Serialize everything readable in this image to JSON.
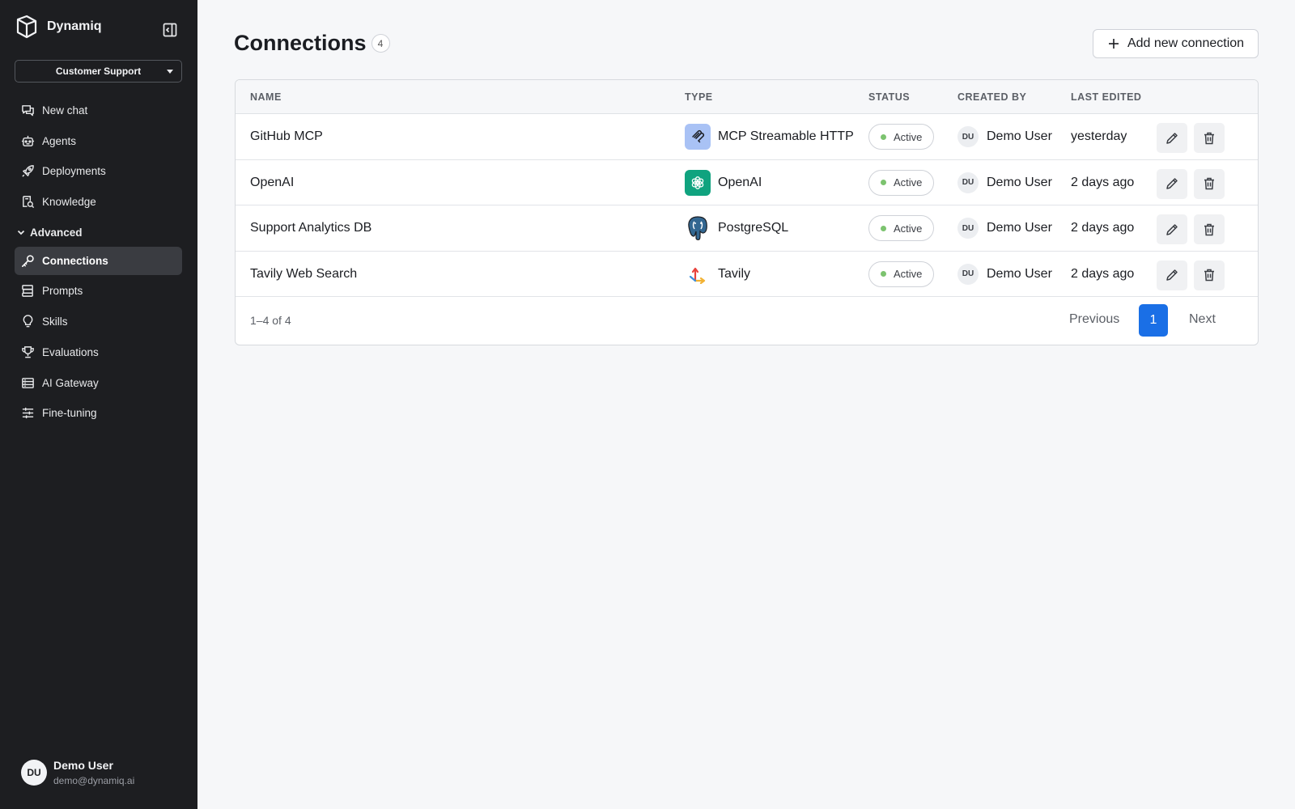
{
  "app": {
    "name": "Dynamiq"
  },
  "sidebar": {
    "workspace": "Customer Support",
    "items": [
      {
        "label": "New chat",
        "icon": "chat-icon"
      },
      {
        "label": "Agents",
        "icon": "robot-icon"
      },
      {
        "label": "Deployments",
        "icon": "rocket-icon"
      },
      {
        "label": "Knowledge",
        "icon": "book-search-icon"
      }
    ],
    "section": "Advanced",
    "advanced_items": [
      {
        "label": "Connections",
        "icon": "key-icon",
        "active": true
      },
      {
        "label": "Prompts",
        "icon": "prompts-icon"
      },
      {
        "label": "Skills",
        "icon": "lightbulb-icon"
      },
      {
        "label": "Evaluations",
        "icon": "trophy-icon"
      },
      {
        "label": "AI Gateway",
        "icon": "server-icon"
      },
      {
        "label": "Fine-tuning",
        "icon": "sliders-icon"
      }
    ],
    "user": {
      "initials": "DU",
      "name": "Demo User",
      "email": "demo@dynamiq.ai"
    }
  },
  "main": {
    "title": "Connections",
    "count": "4",
    "add_button": "Add new connection",
    "table": {
      "headers": [
        "NAME",
        "TYPE",
        "STATUS",
        "CREATED BY",
        "LAST EDITED"
      ],
      "rows": [
        {
          "name": "GitHub MCP",
          "type": "MCP Streamable HTTP",
          "type_icon": "mcp-icon",
          "status": "Active",
          "creator_initials": "DU",
          "creator": "Demo User",
          "edited": "yesterday"
        },
        {
          "name": "OpenAI",
          "type": "OpenAI",
          "type_icon": "openai-icon",
          "status": "Active",
          "creator_initials": "DU",
          "creator": "Demo User",
          "edited": "2 days ago"
        },
        {
          "name": "Support Analytics DB",
          "type": "PostgreSQL",
          "type_icon": "postgresql-icon",
          "status": "Active",
          "creator_initials": "DU",
          "creator": "Demo User",
          "edited": "2 days ago"
        },
        {
          "name": "Tavily Web Search",
          "type": "Tavily",
          "type_icon": "tavily-icon",
          "status": "Active",
          "creator_initials": "DU",
          "creator": "Demo User",
          "edited": "2 days ago"
        }
      ]
    },
    "pagination": {
      "range": "1–4 of 4",
      "previous": "Previous",
      "page": "1",
      "next": "Next"
    }
  },
  "colors": {
    "sidebar_bg": "#1d1e21",
    "accent": "#1a6fe6",
    "status_active": "#7cc36f",
    "openai_green": "#10a37f",
    "mcp_blue": "#a9c2f5"
  }
}
